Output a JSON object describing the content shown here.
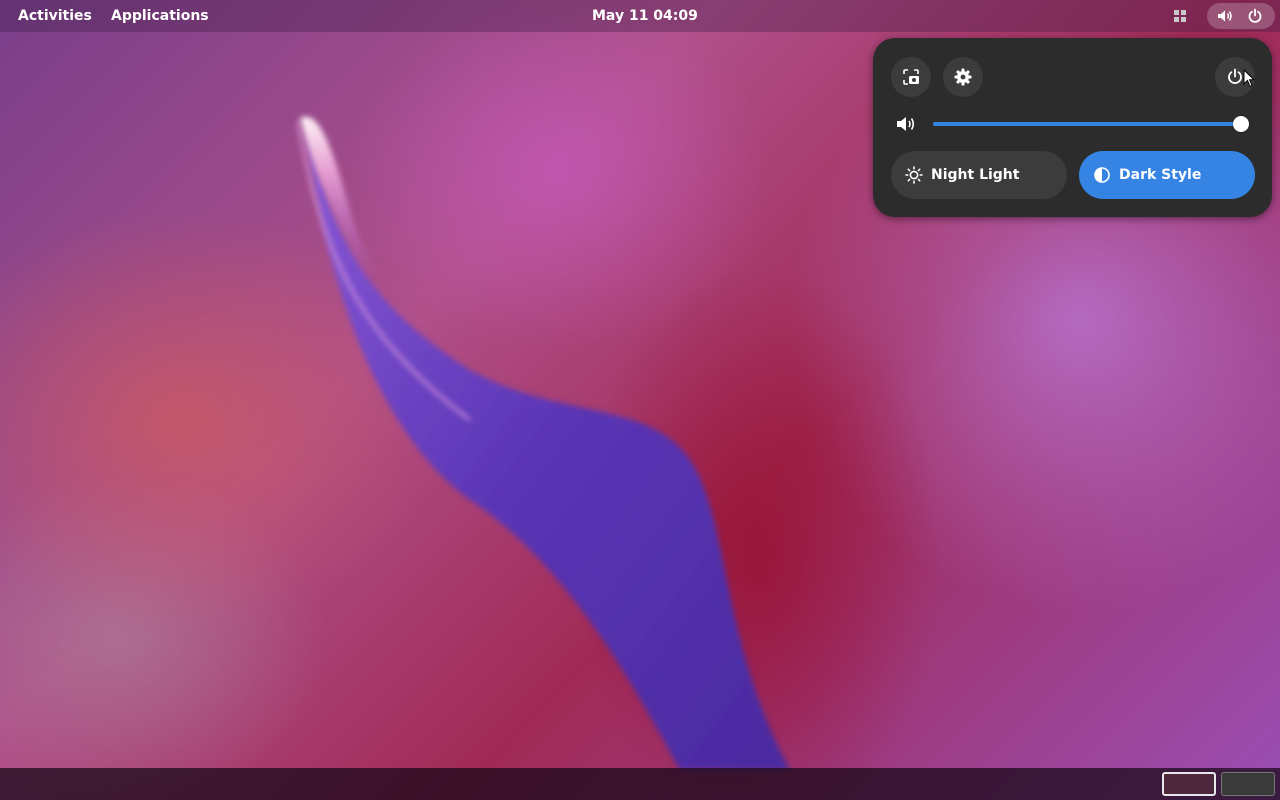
{
  "topbar": {
    "activities_label": "Activities",
    "applications_label": "Applications",
    "clock": "May 11  04:09",
    "workspace_icon": "workspace-grid-icon",
    "status_icons": [
      "volume-icon",
      "power-icon"
    ]
  },
  "quick_settings": {
    "buttons": {
      "screenshot": "screenshot-icon",
      "settings": "gear-icon",
      "power": "power-icon"
    },
    "volume": {
      "icon": "volume-icon",
      "level": 1.0
    },
    "toggles": [
      {
        "label": "Night Light",
        "icon": "night-light-icon",
        "active": false
      },
      {
        "label": "Dark Style",
        "icon": "dark-style-icon",
        "active": true
      }
    ]
  },
  "bottombar": {
    "workspaces": [
      {
        "active": true
      },
      {
        "active": false
      }
    ]
  },
  "colors": {
    "accent": "#3584e4",
    "panel_bg": "#2c2c2c",
    "button_bg": "#3c3c3c"
  }
}
